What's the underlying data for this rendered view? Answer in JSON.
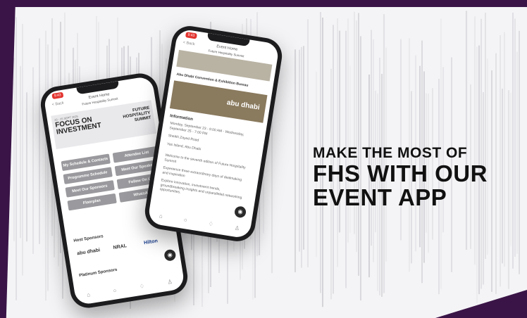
{
  "headline": {
    "line1": "MAKE THE MOST OF",
    "line2": "FHS WITH OUR",
    "line3": "EVENT APP"
  },
  "colors": {
    "frame": "#3a1447",
    "stripes": "#c9c9cf",
    "tile": "#9a9a9e"
  },
  "phone_left": {
    "time": "9:43",
    "back": "< Back",
    "header_title": "Event Home",
    "header_sub": "Future Hospitality Summit",
    "banner_date": "23 - 25 SEPT 2025",
    "banner_title": "FOCUS ON INVESTMENT",
    "banner_right": "FUTURE HOSPITALITY SUMMIT",
    "tiles": [
      "My Schedule & Contacts",
      "Attendee List",
      "Programme Schedule",
      "Meet Our Speakers",
      "Meet Our Sponsors",
      "Follow On Us",
      "Floorplan",
      "WhatsApp"
    ],
    "host_sponsors": "Host Sponsors",
    "sponsors": [
      "abu dhabi",
      "NRAL",
      "Hilton"
    ],
    "platinum_sponsors": "Platinum Sponsors",
    "tab_icons": [
      "home-icon",
      "search-icon",
      "bell-icon",
      "user-icon"
    ]
  },
  "phone_right": {
    "time": "9:43",
    "back": "< Back",
    "header_title": "Event Home",
    "header_sub": "Future Hospitality Summit",
    "venue": "Abu Dhabi Convention & Exhibition Bureau",
    "banner_brand": "abu dhabi",
    "information": "Information",
    "info_lines": [
      "Monday, September 23 - 9:00 AM - Wednesday, September 25 - 7:00 PM",
      "Sheikh Zayed Road",
      "Yas Island, Abu Dhabi",
      "Welcome to the seventh edition of Future Hospitality Summit",
      "Experience three extraordinary days of dealmaking and inspiration",
      "Explore innovation, investment trends, groundbreaking insights and unparalleled networking opportunities."
    ],
    "tab_icons": [
      "home-icon",
      "search-icon",
      "bell-icon",
      "user-icon"
    ]
  }
}
